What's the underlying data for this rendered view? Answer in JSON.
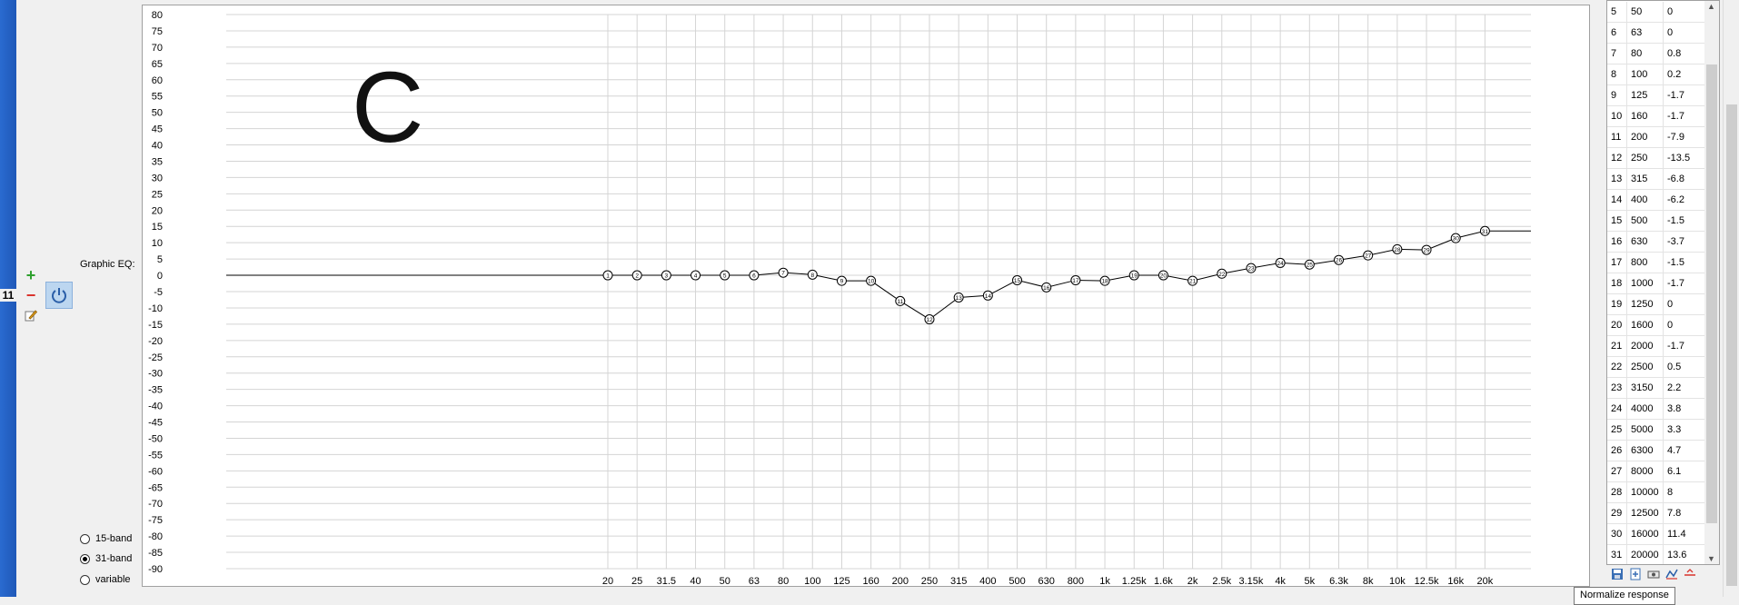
{
  "row_index": "11",
  "equalizer": {
    "label": "Graphic EQ:",
    "band_options": [
      {
        "label": "15-band",
        "selected": false
      },
      {
        "label": "31-band",
        "selected": true
      },
      {
        "label": "variable",
        "selected": false
      }
    ]
  },
  "overlay_letter": "C",
  "tooltip": "Normalize response",
  "table": {
    "rows": [
      [
        "5",
        "50",
        "0"
      ],
      [
        "6",
        "63",
        "0"
      ],
      [
        "7",
        "80",
        "0.8"
      ],
      [
        "8",
        "100",
        "0.2"
      ],
      [
        "9",
        "125",
        "-1.7"
      ],
      [
        "10",
        "160",
        "-1.7"
      ],
      [
        "11",
        "200",
        "-7.9"
      ],
      [
        "12",
        "250",
        "-13.5"
      ],
      [
        "13",
        "315",
        "-6.8"
      ],
      [
        "14",
        "400",
        "-6.2"
      ],
      [
        "15",
        "500",
        "-1.5"
      ],
      [
        "16",
        "630",
        "-3.7"
      ],
      [
        "17",
        "800",
        "-1.5"
      ],
      [
        "18",
        "1000",
        "-1.7"
      ],
      [
        "19",
        "1250",
        "0"
      ],
      [
        "20",
        "1600",
        "0"
      ],
      [
        "21",
        "2000",
        "-1.7"
      ],
      [
        "22",
        "2500",
        "0.5"
      ],
      [
        "23",
        "3150",
        "2.2"
      ],
      [
        "24",
        "4000",
        "3.8"
      ],
      [
        "25",
        "5000",
        "3.3"
      ],
      [
        "26",
        "6300",
        "4.7"
      ],
      [
        "27",
        "8000",
        "6.1"
      ],
      [
        "28",
        "10000",
        "8"
      ],
      [
        "29",
        "12500",
        "7.8"
      ],
      [
        "30",
        "16000",
        "11.4"
      ],
      [
        "31",
        "20000",
        "13.6"
      ]
    ]
  },
  "chart_data": {
    "type": "line",
    "y_ticks": [
      80,
      75,
      70,
      65,
      60,
      55,
      50,
      45,
      40,
      35,
      30,
      25,
      20,
      15,
      10,
      5,
      0,
      -5,
      -10,
      -15,
      -20,
      -25,
      -30,
      -35,
      -40,
      -45,
      -50,
      -55,
      -60,
      -65,
      -70,
      -75,
      -80,
      -85,
      -90
    ],
    "ylim": [
      -90,
      80
    ],
    "x_tick_labels": [
      "20",
      "25",
      "31.5",
      "40",
      "50",
      "63",
      "80",
      "100",
      "125",
      "160",
      "200",
      "250",
      "315",
      "400",
      "500",
      "630",
      "800",
      "1k",
      "1.25k",
      "1.6k",
      "2k",
      "2.5k",
      "3.15k",
      "4k",
      "5k",
      "6.3k",
      "8k",
      "10k",
      "12.5k",
      "16k",
      "20k"
    ],
    "series": [
      {
        "band_numbers": [
          1,
          2,
          3,
          4,
          5,
          6,
          7,
          8,
          9,
          10,
          11,
          12,
          13,
          14,
          15,
          16,
          17,
          18,
          19,
          20,
          21,
          22,
          23,
          24,
          25,
          26,
          27,
          28,
          29,
          30,
          31
        ],
        "values": [
          0,
          0,
          0,
          0,
          0,
          0,
          0.8,
          0.2,
          -1.7,
          -1.7,
          -7.9,
          -13.5,
          -6.8,
          -6.2,
          -1.5,
          -3.7,
          -1.5,
          -1.7,
          0,
          0,
          -1.7,
          0.5,
          2.2,
          3.8,
          3.3,
          4.7,
          6.1,
          8,
          7.8,
          11.4,
          13.6
        ]
      }
    ],
    "grid": true,
    "colors": {
      "line": "#000000",
      "grid": "#d4d4d4",
      "point_fill": "#ffffff"
    }
  }
}
